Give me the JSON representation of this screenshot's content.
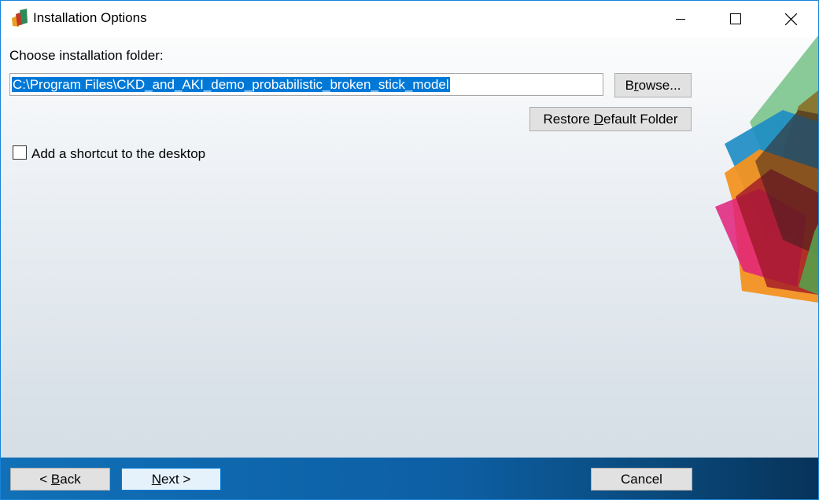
{
  "window": {
    "title": "Installation Options",
    "controls": {
      "minimize": "minimize-icon",
      "maximize": "maximize-icon",
      "close": "close-icon"
    }
  },
  "folder": {
    "label": "Choose installation folder:",
    "path_value": "C:\\Program Files\\CKD_and_AKI_demo_probabilistic_broken_stick_model",
    "browse_pre": "B",
    "browse_ul": "r",
    "browse_post": "owse...",
    "restore_pre": "Restore ",
    "restore_ul": "D",
    "restore_post": "efault Folder"
  },
  "shortcut": {
    "label": "Add a shortcut to the desktop",
    "checked": false
  },
  "footer": {
    "back_pre": "< ",
    "back_ul": "B",
    "back_post": "ack",
    "next_ul": "N",
    "next_post": "ext >",
    "cancel": "Cancel"
  },
  "colors": {
    "accent": "#0078d7",
    "footer_blue": "#0d5fa4",
    "button_face": "#e1e1e1"
  }
}
